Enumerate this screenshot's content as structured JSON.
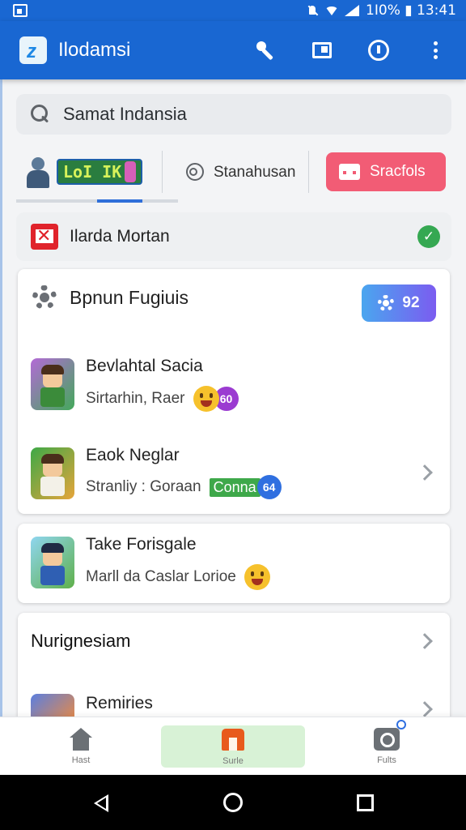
{
  "status_bar": {
    "text": "1I0%  ▮ 13:41"
  },
  "app_bar": {
    "title": "Ilodamsi",
    "icons": [
      "wrench-icon",
      "window-icon",
      "info-icon",
      "more-vert-icon"
    ]
  },
  "search": {
    "value": "Samat Indansia"
  },
  "filters": {
    "game_tag": "LoI IK",
    "middle": "Stanahusan",
    "pill": "Sracfols"
  },
  "alert": {
    "text": "Ilarda Mortan"
  },
  "card": {
    "title": "Bpnun Fugiuis",
    "badge": "92",
    "items": [
      {
        "title": "Bevlahtal Sacia",
        "subtitle": "Sirtarhin, Raer",
        "count": "60"
      },
      {
        "title": "Eaok Neglar",
        "subtitle": "Stranliy : Goraan",
        "tag": "Conna",
        "count": "64"
      }
    ]
  },
  "single_card": {
    "title": "Take Forisgale",
    "subtitle": "Marll da Caslar Lorioe"
  },
  "section": {
    "title": "Nurignesiam",
    "item_title": "Remiries"
  },
  "bottom_nav": [
    {
      "label": "Hast",
      "icon": "home-icon"
    },
    {
      "label": "Surle",
      "icon": "store-icon",
      "active": true
    },
    {
      "label": "Fults",
      "icon": "camera-icon"
    }
  ],
  "colors": {
    "primary": "#1967d2",
    "accent_pill": "#f25c75",
    "active_nav": "#d8f2d6",
    "success": "#35a852"
  }
}
